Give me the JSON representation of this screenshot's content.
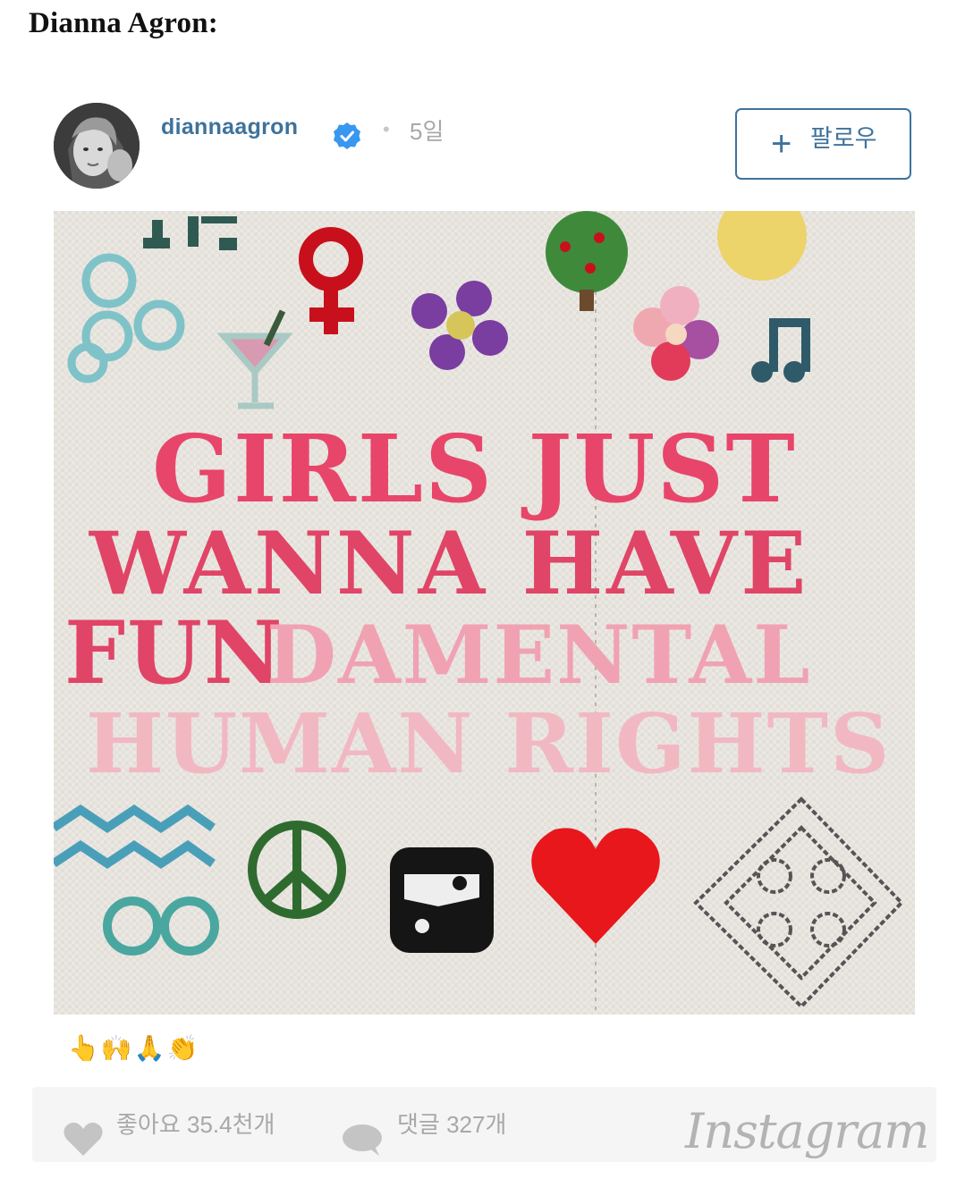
{
  "article": {
    "heading": "Dianna Agron:"
  },
  "post": {
    "username": "diannaagron",
    "separator": "•",
    "time_ago": "5일",
    "follow": {
      "icon": "plus-icon",
      "label": "팔로우"
    },
    "image": {
      "lines": [
        "GIRLS JUST",
        "WANNA HAVE",
        "FUN",
        "DAMENTAL",
        "HUMAN RIGHTS"
      ]
    },
    "caption": "👆🙌🙏👏",
    "stats": {
      "likes_text": "좋아요 35.4천개",
      "comments_text": "댓글 327개",
      "logo": "Instagram"
    }
  },
  "colors": {
    "link_blue": "#3f729b",
    "muted_gray": "#a8a8a8",
    "stitch_red": "#e8456a",
    "stitch_pink": "#f2aab8"
  }
}
